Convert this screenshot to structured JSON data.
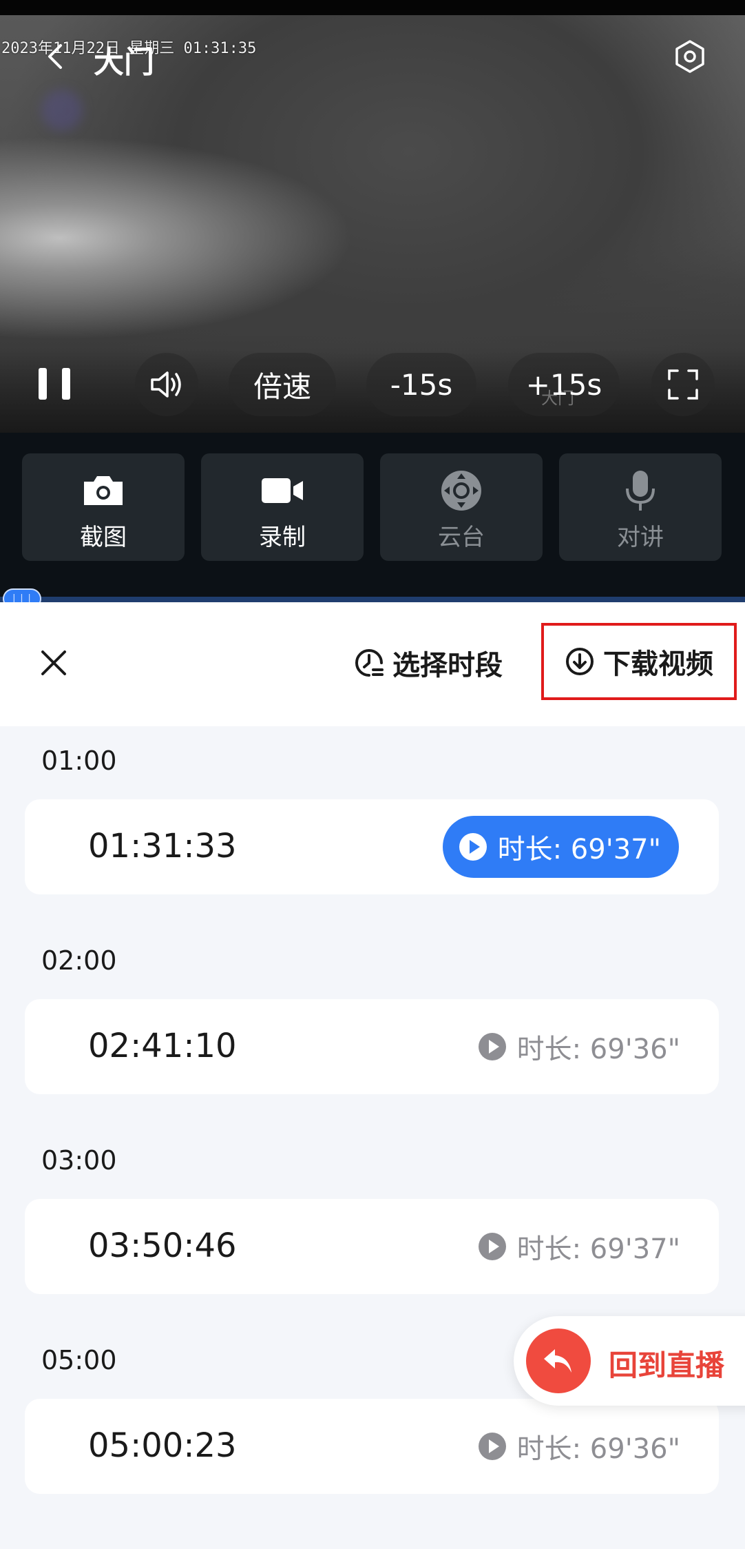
{
  "player": {
    "osd_timestamp": "2023年11月22日 星期三 01:31:35",
    "camera_title": "大门",
    "watermark": "大门",
    "controls": {
      "speed_label": "倍速",
      "rewind_label": "-15s",
      "forward_label": "+15s"
    }
  },
  "toolbar": {
    "items": [
      {
        "label": "截图",
        "icon": "camera-icon",
        "enabled": true
      },
      {
        "label": "录制",
        "icon": "video-camera-icon",
        "enabled": true
      },
      {
        "label": "云台",
        "icon": "ptz-icon",
        "enabled": false
      },
      {
        "label": "对讲",
        "icon": "microphone-icon",
        "enabled": false
      }
    ]
  },
  "sheet": {
    "select_range_label": "选择时段",
    "download_label": "下载视频",
    "groups": [
      {
        "hour": "01:00",
        "time": "01:31:33",
        "duration": "时长:  69'37\"",
        "active": true
      },
      {
        "hour": "02:00",
        "time": "02:41:10",
        "duration": "时长:  69'36\"",
        "active": false
      },
      {
        "hour": "03:00",
        "time": "03:50:46",
        "duration": "时长:  69'37\"",
        "active": false
      },
      {
        "hour": "05:00",
        "time": "05:00:23",
        "duration": "时长:  69'36\"",
        "active": false
      }
    ]
  },
  "back_to_live_label": "回到直播",
  "colors": {
    "accent_blue": "#2f7cf6",
    "live_red": "#f04b3f",
    "highlight_red": "#e01b1b"
  }
}
